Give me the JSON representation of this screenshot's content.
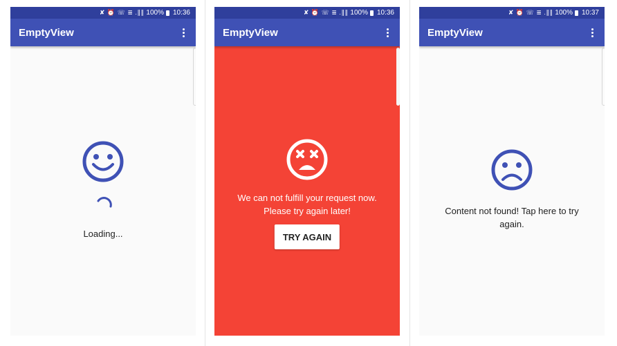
{
  "colors": {
    "primary": "#3f51b5",
    "primary_dark": "#2f3f9c",
    "error_bg": "#f44336",
    "background": "#fafafa",
    "icon": "#3f51b5"
  },
  "screens": [
    {
      "status": {
        "icons": "✘ ⏰ ☏ ≣ .∥∥",
        "battery": "100%",
        "time": "10:36"
      },
      "app_title": "EmptyView",
      "state": "loading",
      "face_icon": "smiley-face-icon",
      "spinner_icon": "loading-spinner-icon",
      "message": "Loading..."
    },
    {
      "status": {
        "icons": "✘ ⏰ ☏ ≣ .∥∥",
        "battery": "100%",
        "time": "10:36"
      },
      "app_title": "EmptyView",
      "state": "error",
      "face_icon": "dead-face-icon",
      "message_line1": "We can not fulfill your request now.",
      "message_line2": "Please try again later!",
      "button_label": "TRY AGAIN"
    },
    {
      "status": {
        "icons": "✘ ⏰ ☏ ≣ .∥∥",
        "battery": "100%",
        "time": "10:37"
      },
      "app_title": "EmptyView",
      "state": "empty",
      "face_icon": "sad-face-icon",
      "message_line1": "Content not found! Tap here to try",
      "message_line2": "again."
    }
  ]
}
